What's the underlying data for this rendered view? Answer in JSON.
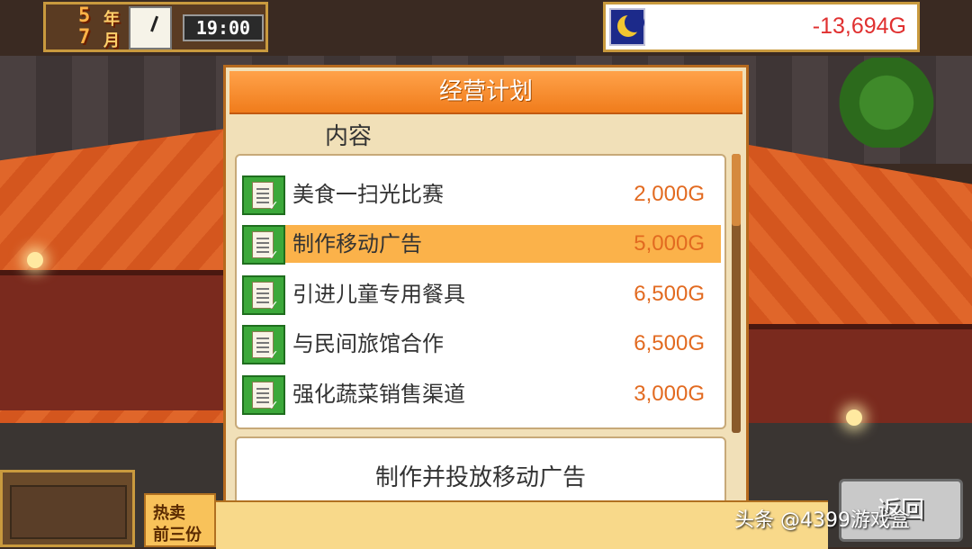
{
  "hud": {
    "date": {
      "year_num": "5",
      "year_label": "年",
      "month_num": "7",
      "month_label": "月"
    },
    "time": "19:00",
    "time_icon": "moon-icon",
    "money": "-13,694G"
  },
  "panel": {
    "title": "经营计划",
    "section_label": "内容",
    "items": [
      {
        "label": "美食一扫光比赛",
        "price": "2,000G",
        "icon": "document-icon",
        "selected": false
      },
      {
        "label": "制作移动广告",
        "price": "5,000G",
        "icon": "document-icon",
        "selected": true
      },
      {
        "label": "引进儿童专用餐具",
        "price": "6,500G",
        "icon": "document-icon",
        "selected": false
      },
      {
        "label": "与民间旅馆合作",
        "price": "6,500G",
        "icon": "document-icon",
        "selected": false
      },
      {
        "label": "强化蔬菜销售渠道",
        "price": "3,000G",
        "icon": "document-icon",
        "selected": false
      }
    ],
    "description": "制作并投放移动广告"
  },
  "bottom": {
    "hot_line1": "热卖",
    "hot_line2": "前三份",
    "back_label": "返回"
  },
  "watermark": "头条 @4399游戏盒",
  "colors": {
    "header_orange": "#f07c1c",
    "selected_row": "#fbb24a",
    "price_orange": "#e26a20",
    "money_red": "#e03030",
    "icon_green": "#3ca83a"
  }
}
